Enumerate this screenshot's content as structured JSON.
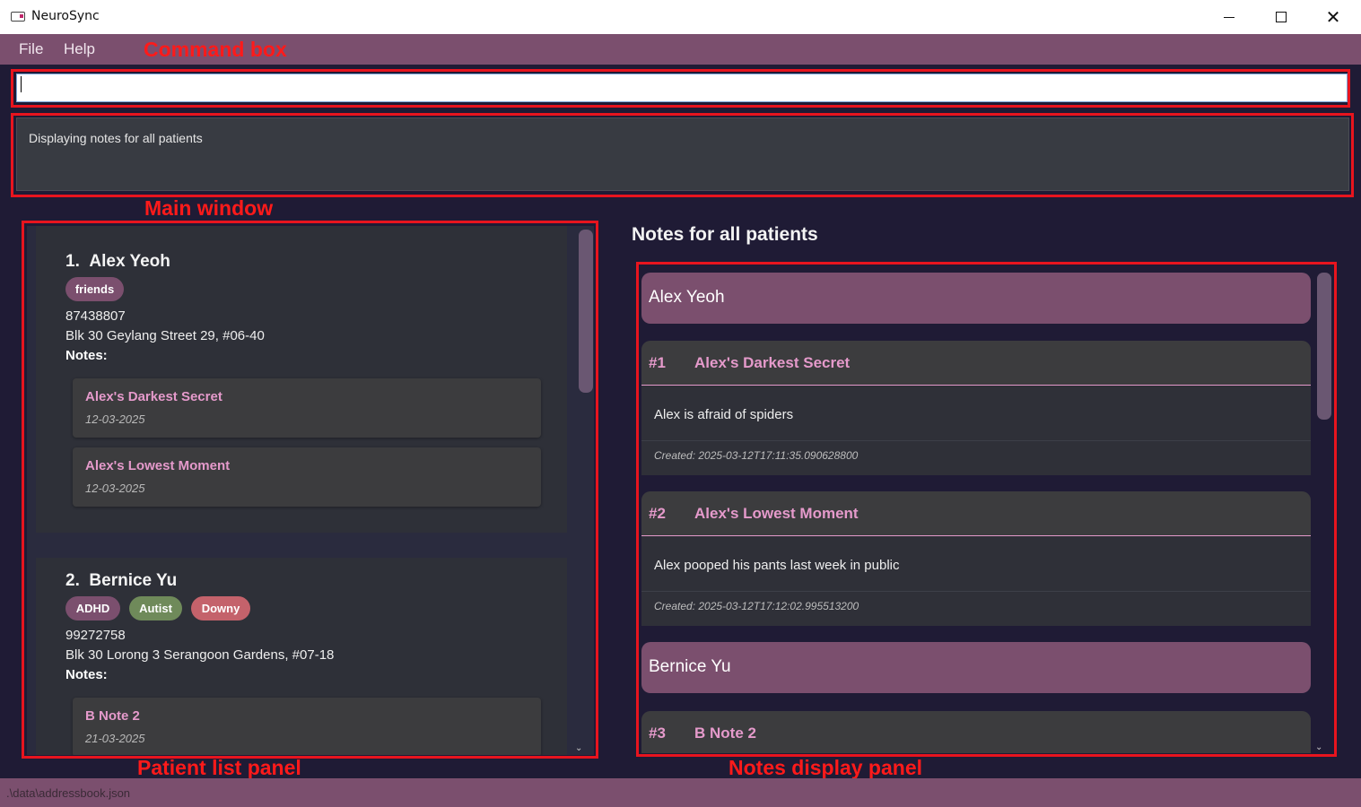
{
  "window": {
    "title": "NeuroSync"
  },
  "menu": {
    "file": "File",
    "help": "Help"
  },
  "annotations": {
    "command_box": "Command box",
    "main_window": "Main window",
    "patient_list_panel": "Patient list panel",
    "notes_display_panel": "Notes display panel"
  },
  "command": {
    "value": ""
  },
  "result": {
    "message": "Displaying notes for all patients"
  },
  "patients": [
    {
      "index": "1.",
      "name": "Alex Yeoh",
      "tags": [
        {
          "label": "friends",
          "color": "#7b4f6e"
        }
      ],
      "phone": "87438807",
      "address": "Blk 30 Geylang Street 29, #06-40",
      "notes_label": "Notes:",
      "notes": [
        {
          "title": "Alex's Darkest Secret",
          "date": "12-03-2025"
        },
        {
          "title": "Alex's Lowest Moment",
          "date": "12-03-2025"
        }
      ]
    },
    {
      "index": "2.",
      "name": "Bernice Yu",
      "tags": [
        {
          "label": "ADHD",
          "color": "#7b4f6e"
        },
        {
          "label": "Autist",
          "color": "#6f8a5a"
        },
        {
          "label": "Downy",
          "color": "#c4626b"
        }
      ],
      "phone": "99272758",
      "address": "Blk 30 Lorong 3 Serangoon Gardens, #07-18",
      "notes_label": "Notes:",
      "notes": [
        {
          "title": "B Note 2",
          "date": "21-03-2025"
        }
      ]
    }
  ],
  "notes_display": {
    "heading": "Notes for all patients",
    "groups": [
      {
        "patient": "Alex Yeoh",
        "notes": [
          {
            "number": "#1",
            "title": "Alex's Darkest Secret",
            "content": "Alex is afraid of spiders",
            "created": "Created: 2025-03-12T17:11:35.090628800"
          },
          {
            "number": "#2",
            "title": "Alex's Lowest Moment",
            "content": "Alex pooped his pants last week in public",
            "created": "Created: 2025-03-12T17:12:02.995513200"
          }
        ]
      },
      {
        "patient": "Bernice Yu",
        "notes": [
          {
            "number": "#3",
            "title": "B Note 2"
          }
        ]
      }
    ]
  },
  "status": {
    "path": ".\\data\\addressbook.json"
  },
  "colors": {
    "accent": "#7b4f6e",
    "note_title": "#e59acb",
    "background": "#1f1b35",
    "annotation": "#ff1a1a"
  }
}
